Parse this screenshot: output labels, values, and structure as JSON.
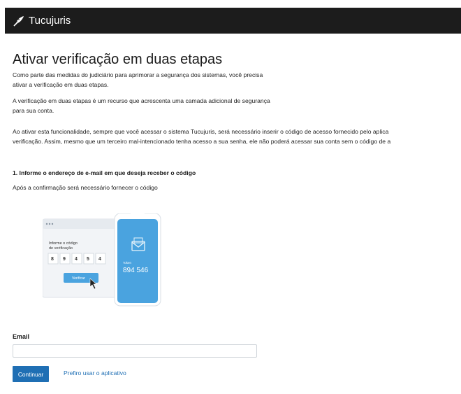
{
  "header": {
    "brand": "Tucujuris",
    "logo_icon": "feather-icon"
  },
  "page": {
    "title": "Ativar verificação em duas etapas",
    "paragraph1_line1": "Como parte das medidas do judiciário para aprimorar a segurança dos sistemas, você precisa",
    "paragraph1_line2": "ativar a verificação em duas etapas.",
    "paragraph2_line1": "A verificação em duas etapas é um recurso que acrescenta uma camada adicional de segurança",
    "paragraph2_line2": "para sua conta.",
    "paragraph3_line1": "Ao ativar esta funcionalidade, sempre que você acessar o sistema Tucujuris, será necessário inserir o código de acesso fornecido pelo aplica",
    "paragraph3_line2": "verificação. Assim, mesmo que um terceiro mal-intencionado tenha acesso a sua senha, ele não poderá acessar sua conta sem o código de a",
    "step1_title": "1. Informe o endereço de e-mail em que deseja receber o código",
    "step1_subtitle": "Após a confirmação será necessário fornecer o código"
  },
  "illustration": {
    "prompt_line1": "Informe o código",
    "prompt_line2": "de verificação",
    "digits": [
      "8",
      "9",
      "4",
      "5",
      "4"
    ],
    "verify_label": "Verificar",
    "token_label": "Token",
    "token_value": "894 546",
    "accent_color": "#4aa3df"
  },
  "form": {
    "email_label": "Email",
    "email_value": "",
    "submit_label": "Continuar",
    "alt_link": "Prefiro usar o aplicativo"
  },
  "colors": {
    "topbar": "#1c1c1c",
    "primary": "#1f6fb4"
  }
}
